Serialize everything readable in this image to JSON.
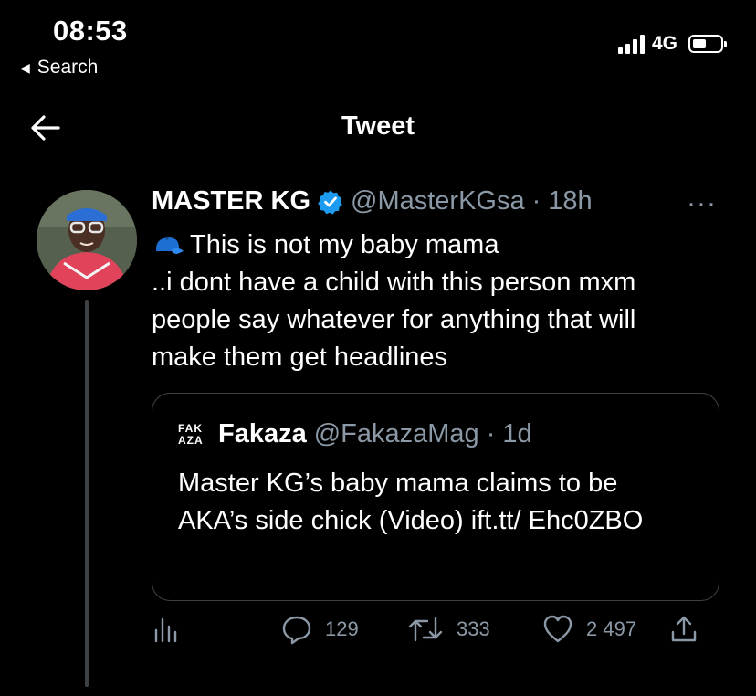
{
  "status_bar": {
    "time": "08:53",
    "back_label": "Search",
    "network": "4G"
  },
  "header": {
    "title": "Tweet"
  },
  "tweet": {
    "author_name": "MASTER KG",
    "author_handle": "@MasterKGsa",
    "separator": "·",
    "time_ago": "18h",
    "more": "···",
    "text": "This is not my baby mama\n..i dont have a child with this person mxm\npeople say whatever for anything  that will\nmake them get headlines",
    "quote": {
      "logo": "FAK AZA",
      "author_name": "Fakaza",
      "author_handle": "@FakazaMag",
      "separator": "·",
      "time_ago": "1d",
      "text": "Master KG’s baby mama claims to be AKA’s side chick (Video) ift.tt/ Ehc0ZBO"
    },
    "stats": {
      "replies": "129",
      "retweets": "333",
      "likes": "2 497"
    }
  },
  "icons": {
    "nav_back": "arrow-left-icon",
    "verified": "verified-badge-icon",
    "emoji": "billed-cap-emoji-icon",
    "analytics": "analytics-icon",
    "reply": "reply-icon",
    "retweet": "retweet-icon",
    "like": "heart-icon",
    "share": "share-icon"
  },
  "colors": {
    "background": "#000000",
    "text": "#ffffff",
    "secondary_text": "#8b98a5",
    "verified": "#1d9bf0",
    "border": "#3e4144"
  }
}
